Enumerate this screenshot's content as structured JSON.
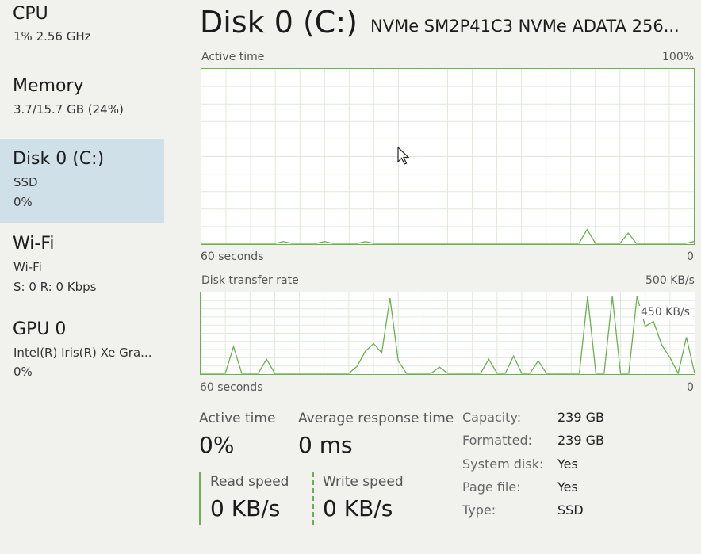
{
  "sidebar": {
    "items": [
      {
        "title": "CPU",
        "line1": "1% 2.56 GHz",
        "line2": ""
      },
      {
        "title": "Memory",
        "line1": "3.7/15.7 GB (24%)",
        "line2": ""
      },
      {
        "title": "Disk 0 (C:)",
        "line1": "SSD",
        "line2": "0%"
      },
      {
        "title": "Wi-Fi",
        "line1": "Wi-Fi",
        "line2": "S: 0 R: 0 Kbps"
      },
      {
        "title": "GPU 0",
        "line1": "Intel(R) Iris(R) Xe Gra...",
        "line2": "0%"
      }
    ]
  },
  "header": {
    "title": "Disk 0 (C:)",
    "device": "NVMe SM2P41C3 NVMe ADATA 256..."
  },
  "active_graph": {
    "label": "Active time",
    "max_label": "100%",
    "time_label": "60 seconds",
    "min_label": "0"
  },
  "transfer_graph": {
    "label": "Disk transfer rate",
    "max_label": "500 KB/s",
    "mid_label": "450 KB/s",
    "time_label": "60 seconds",
    "min_label": "0"
  },
  "stats": {
    "active_time_label": "Active time",
    "active_time_value": "0%",
    "avg_response_label": "Average response time",
    "avg_response_value": "0 ms",
    "read_label": "Read speed",
    "read_value": "0 KB/s",
    "write_label": "Write speed",
    "write_value": "0 KB/s"
  },
  "properties": [
    {
      "key": "Capacity:",
      "value": "239 GB"
    },
    {
      "key": "Formatted:",
      "value": "239 GB"
    },
    {
      "key": "System disk:",
      "value": "Yes"
    },
    {
      "key": "Page file:",
      "value": "Yes"
    },
    {
      "key": "Type:",
      "value": "SSD"
    }
  ],
  "colors": {
    "accent": "#6ab04c",
    "selected_bg": "#cfe0e8"
  },
  "chart_data": [
    {
      "type": "line",
      "title": "Active time",
      "xlabel": "60 seconds",
      "ylim": [
        0,
        100
      ],
      "series": [
        {
          "values": [
            0,
            0,
            0,
            0,
            0,
            0,
            0,
            0,
            0,
            0,
            1,
            0,
            0,
            0,
            0,
            1,
            0,
            0,
            0,
            0,
            1,
            0,
            0,
            0,
            0,
            0,
            0,
            0,
            0,
            0,
            0,
            0,
            0,
            0,
            0,
            0,
            0,
            0,
            0,
            0,
            0,
            0,
            0,
            0,
            0,
            0,
            0,
            8,
            0,
            0,
            0,
            0,
            6,
            0,
            0,
            0,
            0,
            0,
            0,
            0,
            1
          ]
        }
      ]
    },
    {
      "type": "line",
      "title": "Disk transfer rate",
      "xlabel": "60 seconds",
      "ylim": [
        0,
        500
      ],
      "series": [
        {
          "values": [
            0,
            0,
            0,
            0,
            170,
            0,
            0,
            0,
            90,
            0,
            0,
            0,
            0,
            0,
            0,
            0,
            0,
            0,
            0,
            45,
            140,
            190,
            130,
            480,
            80,
            0,
            0,
            0,
            0,
            40,
            0,
            0,
            0,
            0,
            0,
            90,
            0,
            0,
            110,
            0,
            0,
            80,
            0,
            0,
            0,
            0,
            0,
            490,
            0,
            0,
            490,
            0,
            0,
            490,
            300,
            330,
            180,
            100,
            0,
            230,
            0
          ]
        }
      ]
    }
  ]
}
